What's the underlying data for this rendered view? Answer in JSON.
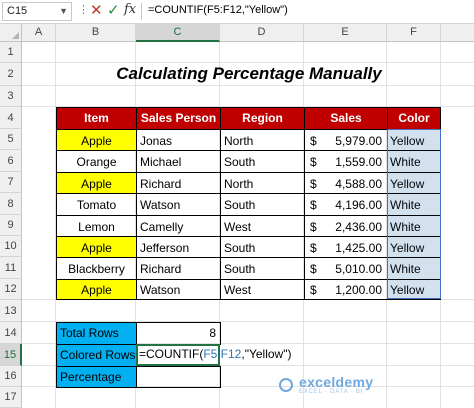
{
  "formula_bar": {
    "name_box": "C15",
    "formula": "=COUNTIF(F5:F12,\"Yellow\")"
  },
  "columns": [
    "A",
    "B",
    "C",
    "D",
    "E",
    "F"
  ],
  "rows": [
    "1",
    "2",
    "3",
    "4",
    "5",
    "6",
    "7",
    "8",
    "9",
    "10",
    "11",
    "12",
    "13",
    "14",
    "15",
    "16",
    "17"
  ],
  "sheet": {
    "title": "Calculating Percentage Manually",
    "headers": [
      "Item",
      "Sales Person",
      "Region",
      "Sales",
      "Color"
    ],
    "records": [
      {
        "item": "Apple",
        "person": "Jonas",
        "region": "North",
        "currency": "$",
        "sales": "5,979.00",
        "color": "Yellow",
        "highlight": true
      },
      {
        "item": "Orange",
        "person": "Michael",
        "region": "South",
        "currency": "$",
        "sales": "1,559.00",
        "color": "White",
        "highlight": false
      },
      {
        "item": "Apple",
        "person": "Richard",
        "region": "North",
        "currency": "$",
        "sales": "4,588.00",
        "color": "Yellow",
        "highlight": true
      },
      {
        "item": "Tomato",
        "person": "Watson",
        "region": "South",
        "currency": "$",
        "sales": "4,196.00",
        "color": "White",
        "highlight": false
      },
      {
        "item": "Lemon",
        "person": "Camelly",
        "region": "West",
        "currency": "$",
        "sales": "2,436.00",
        "color": "White",
        "highlight": false
      },
      {
        "item": "Apple",
        "person": "Jefferson",
        "region": "South",
        "currency": "$",
        "sales": "1,425.00",
        "color": "Yellow",
        "highlight": true
      },
      {
        "item": "Blackberry",
        "person": "Richard",
        "region": "South",
        "currency": "$",
        "sales": "5,010.00",
        "color": "White",
        "highlight": false
      },
      {
        "item": "Apple",
        "person": "Watson",
        "region": "West",
        "currency": "$",
        "sales": "1,200.00",
        "color": "Yellow",
        "highlight": true
      }
    ],
    "summary": {
      "total_rows_label": "Total Rows",
      "total_rows_value": "8",
      "colored_rows_label": "Colored Rows",
      "colored_rows_formula": {
        "prefix": "=COUNTIF(",
        "ref": "F5:F12",
        "suffix": ",\"Yellow\")"
      },
      "percentage_label": "Percentage"
    },
    "yellow_color": "#ffff00",
    "header_color": "#c00000",
    "summary_label_color": "#00b0f0"
  },
  "watermark": {
    "brand": "exceldemy",
    "tagline": "EXCEL · DATA · BI"
  }
}
